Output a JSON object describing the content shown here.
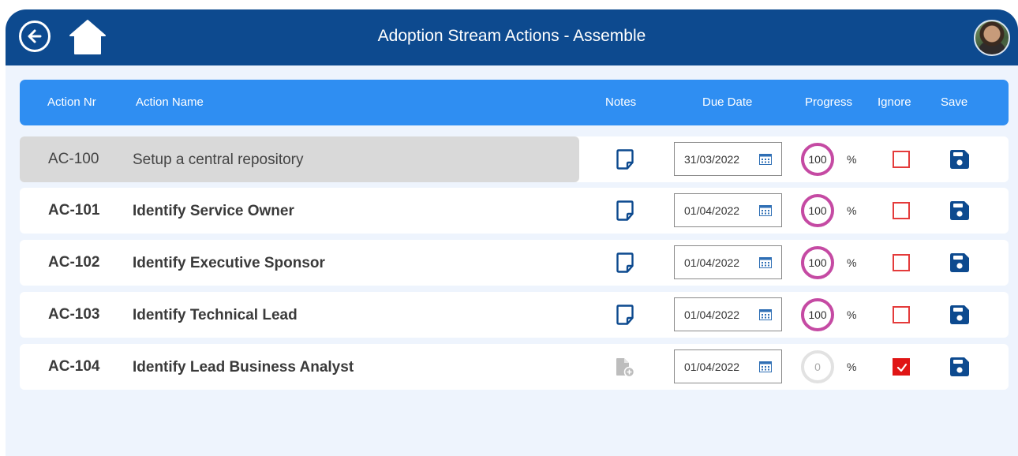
{
  "app": {
    "title": "Adoption Stream Actions - Assemble"
  },
  "header": {
    "action_nr": "Action Nr",
    "action_name": "Action Name",
    "notes": "Notes",
    "due_date": "Due Date",
    "progress": "Progress",
    "ignore": "Ignore",
    "save": "Save"
  },
  "rows": [
    {
      "nr": "AC-100",
      "name": "Setup a central repository",
      "due_date": "31/03/2022",
      "progress": "100",
      "pct_symbol": "%",
      "ignored": false,
      "note_icon": "note-icon",
      "selected": true
    },
    {
      "nr": "AC-101",
      "name": "Identify Service Owner",
      "due_date": "01/04/2022",
      "progress": "100",
      "pct_symbol": "%",
      "ignored": false,
      "note_icon": "note-icon",
      "selected": false
    },
    {
      "nr": "AC-102",
      "name": "Identify Executive Sponsor",
      "due_date": "01/04/2022",
      "progress": "100",
      "pct_symbol": "%",
      "ignored": false,
      "note_icon": "note-icon",
      "selected": false
    },
    {
      "nr": "AC-103",
      "name": "Identify Technical Lead",
      "due_date": "01/04/2022",
      "progress": "100",
      "pct_symbol": "%",
      "ignored": false,
      "note_icon": "note-icon",
      "selected": false
    },
    {
      "nr": "AC-104",
      "name": "Identify Lead Business Analyst",
      "due_date": "01/04/2022",
      "progress": "0",
      "pct_symbol": "%",
      "ignored": true,
      "note_icon": "add-note-icon",
      "selected": false
    }
  ],
  "colors": {
    "titlebar": "#0d4a8f",
    "header": "#2f8ef2",
    "progress_ring": "#c54aa3",
    "ignore": "#e01515",
    "save_icon": "#0d4a8f"
  }
}
